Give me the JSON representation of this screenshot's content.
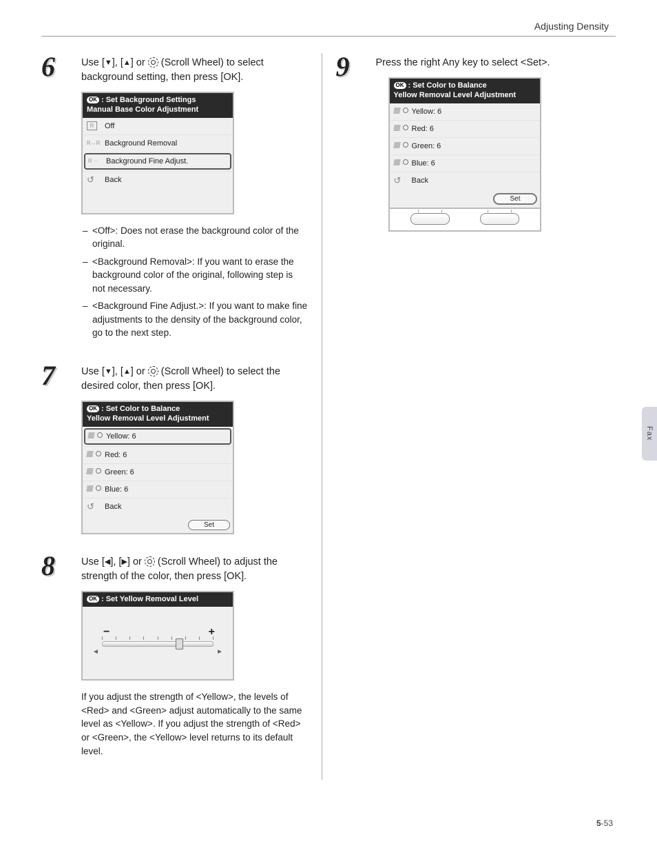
{
  "header": {
    "title": "Adjusting Density"
  },
  "side_tab": "Fax",
  "page_number": {
    "chapter": "5",
    "page": "53"
  },
  "step6": {
    "num": "6",
    "text_parts": [
      "Use [",
      "▼",
      "], [",
      "▲",
      "] or ",
      " (Scroll Wheel) to select background setting, then press [OK]."
    ],
    "lcd": {
      "title_prefix": "OK",
      "title_line1": ": Set Background Settings",
      "title_line2": "Manual Base Color Adjustment",
      "rows": [
        {
          "icon": "R",
          "label": "Off"
        },
        {
          "icon": "R→R",
          "label": "Background Removal"
        },
        {
          "icon": "R→··",
          "label": "Background Fine Adjust.",
          "selected": true
        },
        {
          "icon": "↩",
          "label": "Back"
        }
      ]
    },
    "desc": [
      "<Off>: Does not erase the background color of the original.",
      "<Background Removal>: If you want to erase the background color of the original, following step is not necessary.",
      "<Background Fine Adjust.>: If you want to make fine adjustments to the density of the background color, go to the next step."
    ]
  },
  "step7": {
    "num": "7",
    "text_parts": [
      "Use [",
      "▼",
      "], [",
      "▲",
      "] or ",
      " (Scroll Wheel) to select the desired color, then press [OK]."
    ],
    "lcd": {
      "title_prefix": "OK",
      "title_line1": ": Set Color to Balance",
      "title_line2": "Yellow Removal Level Adjustment",
      "rows": [
        {
          "label": "Yellow: 6",
          "selected": true
        },
        {
          "label": "Red: 6"
        },
        {
          "label": "Green: 6"
        },
        {
          "label": "Blue: 6"
        },
        {
          "icon": "↩",
          "label": "Back"
        }
      ],
      "footer_button": "Set"
    }
  },
  "step8": {
    "num": "8",
    "text_parts": [
      "Use [",
      "◀",
      "], [",
      "▶",
      "] or ",
      " (Scroll Wheel) to adjust the strength of the color, then press [OK]."
    ],
    "lcd": {
      "title_prefix": "OK",
      "title_line1": ": Set Yellow Removal Level",
      "minus": "−",
      "plus": "+"
    },
    "after_text": "If you adjust the strength of <Yellow>, the levels of <Red> and <Green> adjust automatically to the same level as <Yellow>. If you adjust the strength of <Red> or <Green>, the <Yellow> level returns to its default level."
  },
  "step9": {
    "num": "9",
    "text": "Press the right Any key to select <Set>.",
    "lcd": {
      "title_prefix": "OK",
      "title_line1": ": Set Color to Balance",
      "title_line2": "Yellow Removal Level Adjustment",
      "rows": [
        {
          "label": "Yellow: 6"
        },
        {
          "label": "Red: 6"
        },
        {
          "label": "Green: 6"
        },
        {
          "label": "Blue: 6"
        },
        {
          "icon": "↩",
          "label": "Back"
        }
      ],
      "footer_button": "Set"
    }
  }
}
